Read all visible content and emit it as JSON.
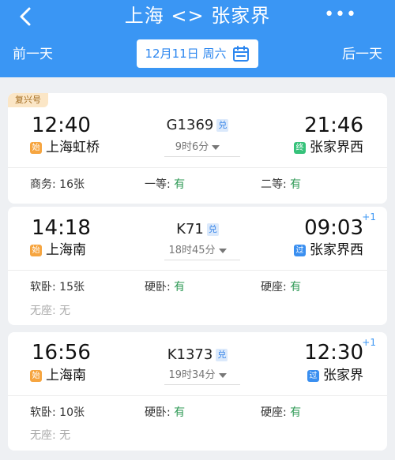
{
  "header": {
    "title": "上海 <> 张家界",
    "more": "•••",
    "prev_day": "前一天",
    "next_day": "后一天",
    "date": "12月11日 周六"
  },
  "colors": {
    "brand": "#3a96f4",
    "available": "#2f9a56"
  },
  "trains": [
    {
      "badge": "复兴号",
      "dep_time": "12:40",
      "dep_tag": "始",
      "dep_station": "上海虹桥",
      "train_no": "G1369",
      "exchange": "兑",
      "duration": "9时6分",
      "arr_time": "21:46",
      "arr_plus": "",
      "arr_tag": "终",
      "arr_station": "张家界西",
      "seats": [
        {
          "label": "商务: ",
          "value": "16张"
        },
        {
          "label": "一等: ",
          "value": "有"
        },
        {
          "label": "二等: ",
          "value": "有"
        }
      ]
    },
    {
      "dep_time": "14:18",
      "dep_tag": "始",
      "dep_station": "上海南",
      "train_no": "K71",
      "exchange": "兑",
      "duration": "18时45分",
      "arr_time": "09:03",
      "arr_plus": "+1",
      "arr_tag": "过",
      "arr_station": "张家界西",
      "seats": [
        {
          "label": "软卧: ",
          "value": "15张"
        },
        {
          "label": "硬卧: ",
          "value": "有"
        },
        {
          "label": "硬座: ",
          "value": "有"
        },
        {
          "label": "无座: ",
          "value": "无"
        }
      ]
    },
    {
      "dep_time": "16:56",
      "dep_tag": "始",
      "dep_station": "上海南",
      "train_no": "K1373",
      "exchange": "兑",
      "duration": "19时34分",
      "arr_time": "12:30",
      "arr_plus": "+1",
      "arr_tag": "过",
      "arr_station": "张家界",
      "seats": [
        {
          "label": "软卧: ",
          "value": "10张"
        },
        {
          "label": "硬卧: ",
          "value": "有"
        },
        {
          "label": "硬座: ",
          "value": "有"
        },
        {
          "label": "无座: ",
          "value": "无"
        }
      ]
    }
  ]
}
